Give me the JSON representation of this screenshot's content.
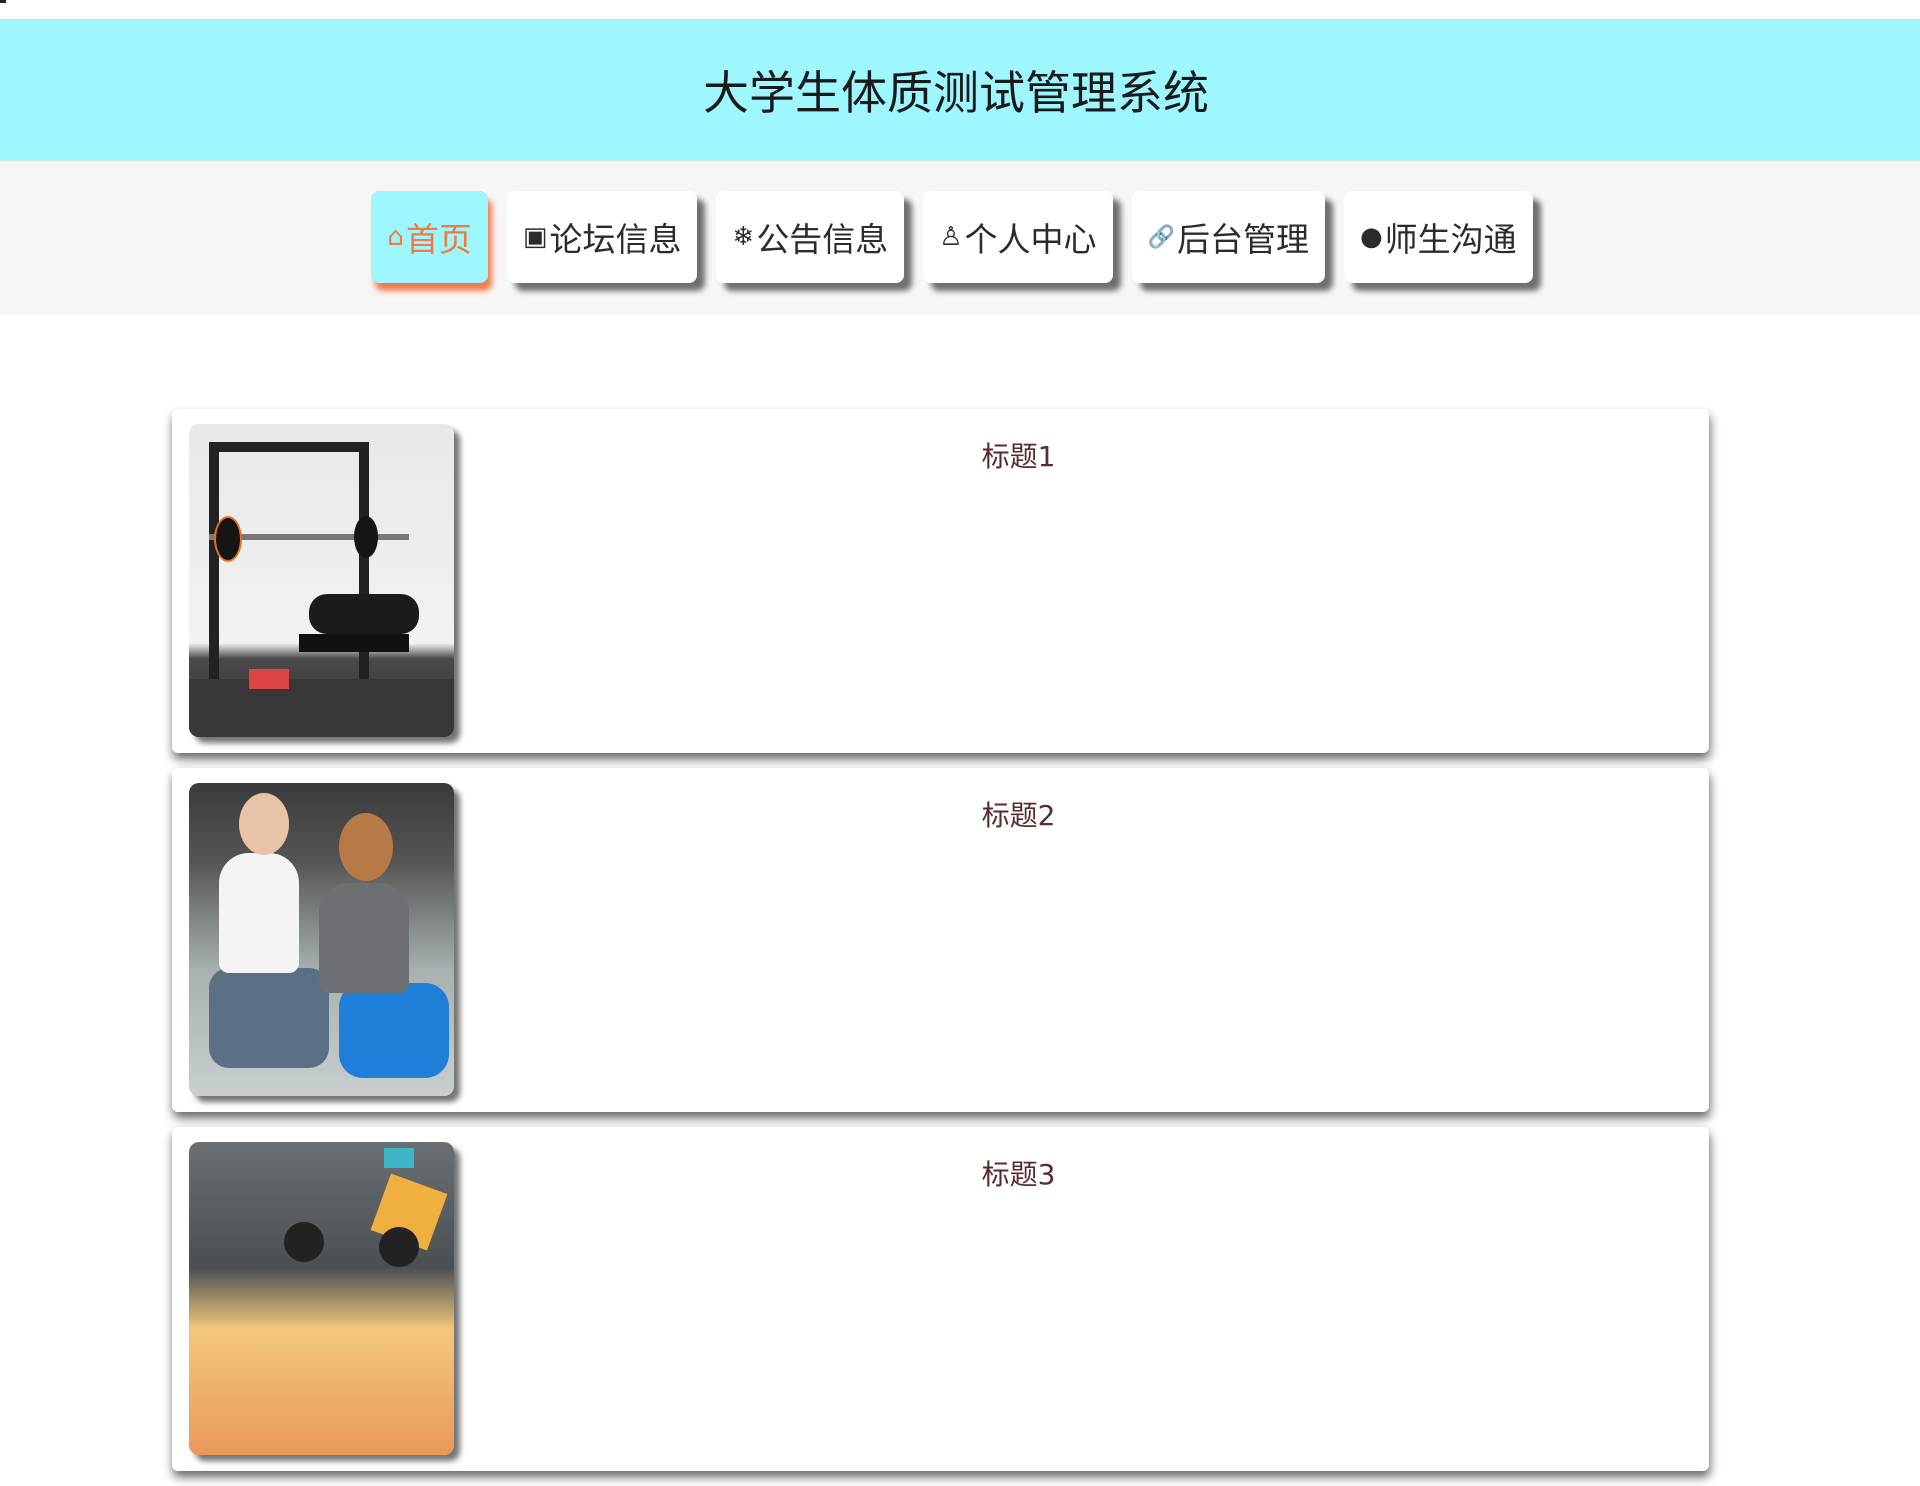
{
  "header": {
    "title": "大学生体质测试管理系统",
    "background": "#9ef6fe"
  },
  "nav": {
    "items": [
      {
        "label": "首页",
        "icon": "home-icon",
        "glyph": "⌂",
        "active": true
      },
      {
        "label": "论坛信息",
        "icon": "grid-icon",
        "glyph": "▣",
        "active": false
      },
      {
        "label": "公告信息",
        "icon": "snowflake-icon",
        "glyph": "❄",
        "active": false
      },
      {
        "label": "个人中心",
        "icon": "user-icon",
        "glyph": "♙",
        "active": false
      },
      {
        "label": "后台管理",
        "icon": "link-icon",
        "glyph": "🔗",
        "active": false
      },
      {
        "label": "师生沟通",
        "icon": "wechat-icon",
        "glyph": "●",
        "active": false
      }
    ],
    "active_color": "#ef7b42"
  },
  "list": {
    "items": [
      {
        "title": "标题1",
        "image": "gym-equipment-photo"
      },
      {
        "title": "标题2",
        "image": "fitness-training-photo"
      },
      {
        "title": "标题3",
        "image": "group-exercise-photo"
      }
    ]
  }
}
